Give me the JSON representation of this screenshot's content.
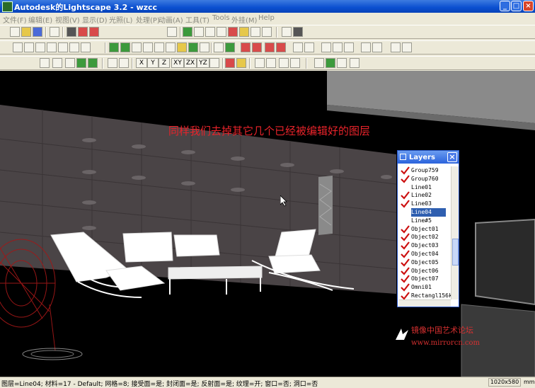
{
  "window": {
    "title": "Autodesk的Lightscape 3.2 - wzcc",
    "min": "_",
    "max": "□",
    "close": "×"
  },
  "menu": [
    "文件(F)",
    "编辑(E)",
    "视图(V)",
    "显示(D)",
    "光照(L)",
    "处理(P)",
    "动画(A)",
    "工具(T)",
    "Tools",
    "外挂(M)",
    "Help"
  ],
  "toolbar": {
    "x": "X",
    "y": "Y",
    "z": "Z",
    "xy": "XY",
    "zx": "ZX",
    "yz": "YZ"
  },
  "annotation": "同样我们去掉其它几个已经被编辑好的图层",
  "layers_panel": {
    "title": "Layers",
    "close": "×",
    "layers": [
      {
        "name": "Group759",
        "checked": true
      },
      {
        "name": "Group760",
        "checked": true
      },
      {
        "name": "Line01",
        "checked": false
      },
      {
        "name": "Line02",
        "checked": true
      },
      {
        "name": "Line03",
        "checked": true
      },
      {
        "name": "Line04",
        "checked": false,
        "selected": true
      },
      {
        "name": "Line#5",
        "checked": false
      },
      {
        "name": "Object01",
        "checked": true
      },
      {
        "name": "Object02",
        "checked": true
      },
      {
        "name": "Object03",
        "checked": true
      },
      {
        "name": "Object04",
        "checked": true
      },
      {
        "name": "Object05",
        "checked": true
      },
      {
        "name": "Object06",
        "checked": true
      },
      {
        "name": "Object07",
        "checked": true
      },
      {
        "name": "Omni01",
        "checked": true
      },
      {
        "name": "Rectangl156k",
        "checked": true
      }
    ]
  },
  "watermark": {
    "site_name": "镜像中国艺术论坛",
    "url": "www.mirrorcn.com"
  },
  "status": {
    "text": "图层=Line04; 材料=17 - Default; 网格=8; 接受面=是; 封闭面=是; 反射面=是; 纹理=开; 窗口=否; 洞口=否",
    "resolution": "1020x580",
    "unit": "mm"
  },
  "colors": {
    "annotation": "#e8232a",
    "selection": "#2f5fb0",
    "check": "#cc1010"
  }
}
